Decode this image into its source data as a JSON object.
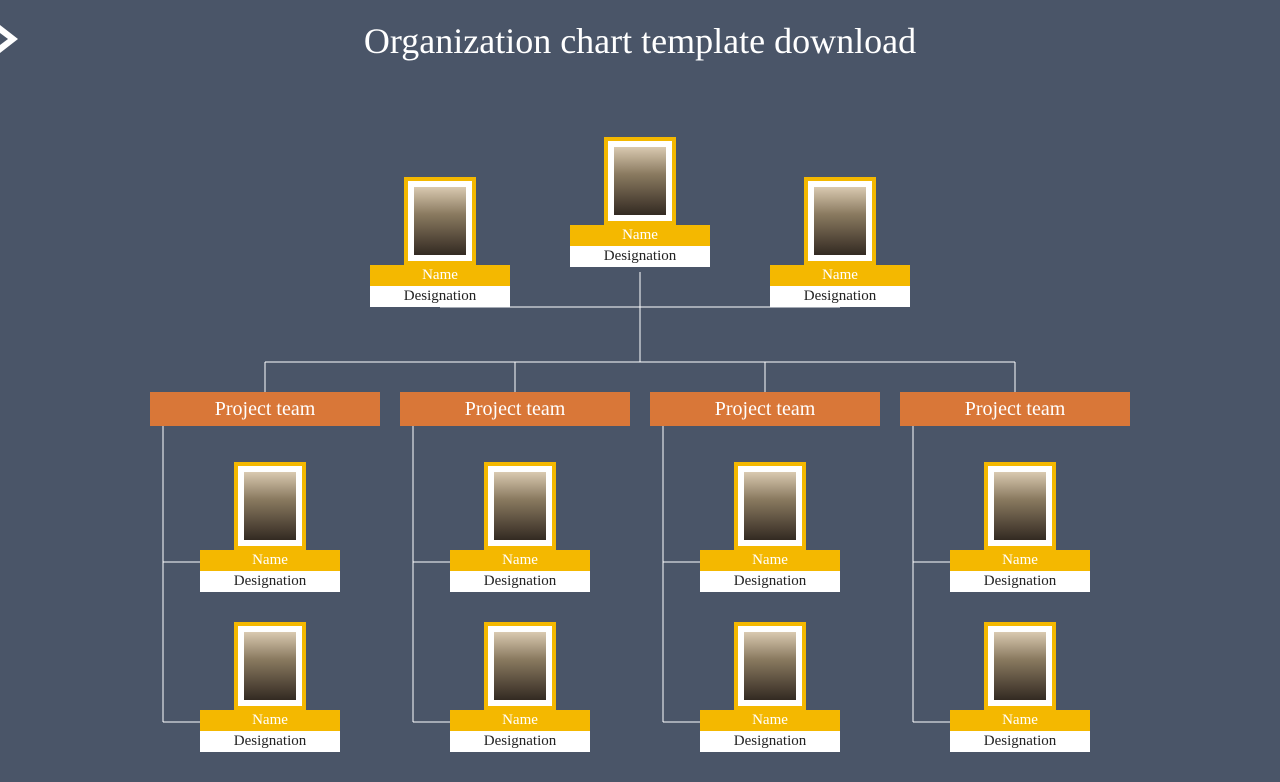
{
  "title": "Organization chart template download",
  "top": {
    "ceo": {
      "name": "Name",
      "designation": "Designation"
    },
    "left": {
      "name": "Name",
      "designation": "Designation"
    },
    "right": {
      "name": "Name",
      "designation": "Designation"
    }
  },
  "teams": [
    {
      "label": "Project team",
      "members": [
        {
          "name": "Name",
          "designation": "Designation"
        },
        {
          "name": "Name",
          "designation": "Designation"
        }
      ]
    },
    {
      "label": "Project team",
      "members": [
        {
          "name": "Name",
          "designation": "Designation"
        },
        {
          "name": "Name",
          "designation": "Designation"
        }
      ]
    },
    {
      "label": "Project team",
      "members": [
        {
          "name": "Name",
          "designation": "Designation"
        },
        {
          "name": "Name",
          "designation": "Designation"
        }
      ]
    },
    {
      "label": "Project team",
      "members": [
        {
          "name": "Name",
          "designation": "Designation"
        },
        {
          "name": "Name",
          "designation": "Designation"
        }
      ]
    }
  ],
  "colors": {
    "background": "#4a5568",
    "accent": "#f4b800",
    "team": "#d97738"
  }
}
